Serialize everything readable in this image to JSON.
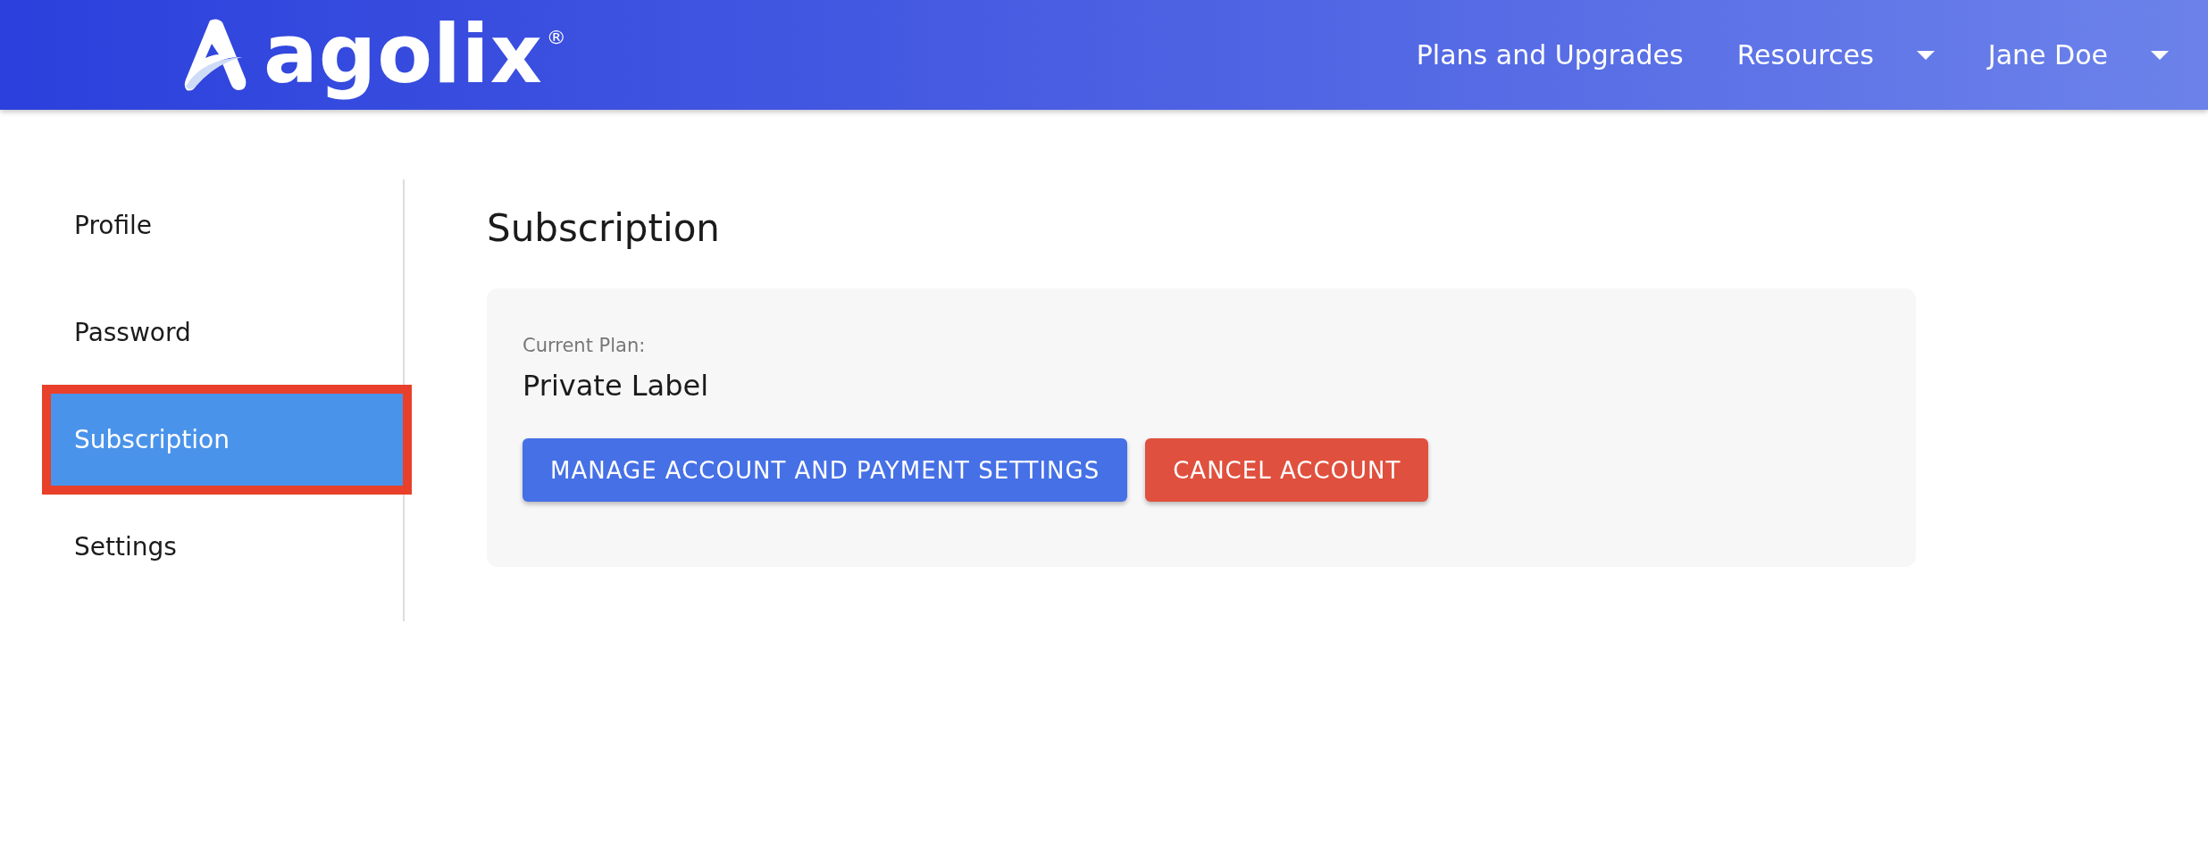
{
  "header": {
    "logo": {
      "text": "agolix",
      "mark": "®"
    },
    "nav": [
      {
        "label": "Plans and Upgrades",
        "dropdown": false
      },
      {
        "label": "Resources",
        "dropdown": true
      },
      {
        "label": "Jane Doe",
        "dropdown": true
      }
    ]
  },
  "sidebar": {
    "items": [
      {
        "label": "Profile",
        "selected": false,
        "highlighted": false
      },
      {
        "label": "Password",
        "selected": false,
        "highlighted": false
      },
      {
        "label": "Subscription",
        "selected": true,
        "highlighted": true
      },
      {
        "label": "Settings",
        "selected": false,
        "highlighted": false
      }
    ]
  },
  "main": {
    "title": "Subscription",
    "card": {
      "label": "Current Plan:",
      "value": "Private Label",
      "buttons": [
        {
          "label": "MANAGE ACCOUNT AND PAYMENT SETTINGS",
          "kind": "primary"
        },
        {
          "label": "CANCEL ACCOUNT",
          "kind": "danger"
        }
      ]
    }
  }
}
